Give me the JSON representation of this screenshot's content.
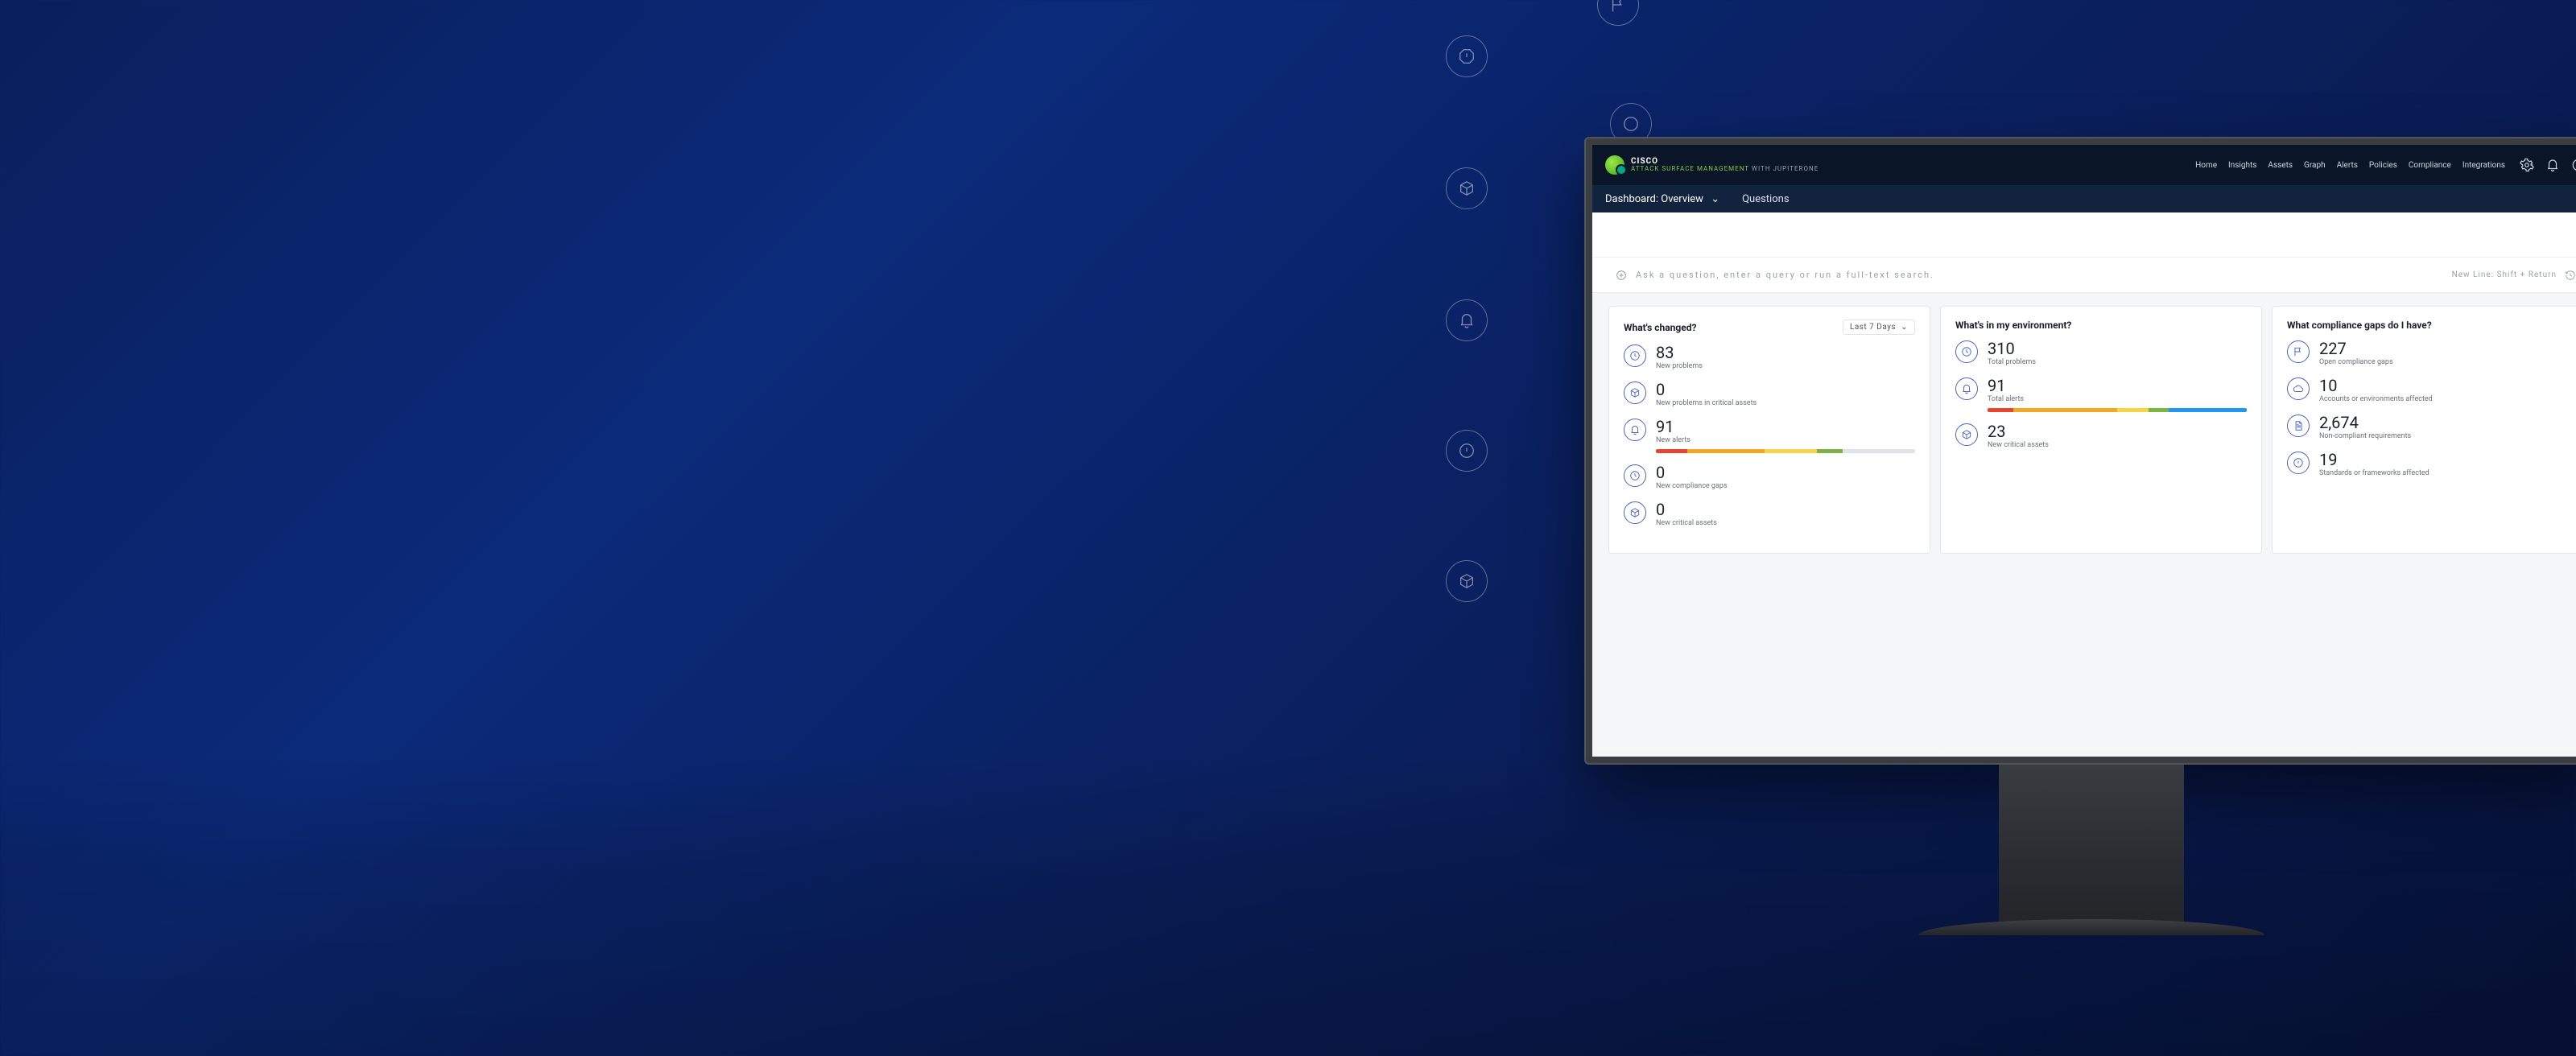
{
  "brand": {
    "top": "CISCO",
    "green": "ATTACK SURFACE MANAGEMENT",
    "grey": "WITH JUPITERONE"
  },
  "nav": {
    "home": "Home",
    "insights": "Insights",
    "assets": "Assets",
    "graph": "Graph",
    "alerts": "Alerts",
    "policies": "Policies",
    "compliance": "Compliance",
    "integrations": "Integrations"
  },
  "subnav": {
    "dashboard": "Dashboard: Overview",
    "questions": "Questions"
  },
  "search": {
    "placeholder": "Ask a question, enter a query or run a full-text search.",
    "hint": "New Line:  Shift + Return"
  },
  "cards": {
    "changed": {
      "title": "What's changed?",
      "range": "Last 7 Days",
      "m1": {
        "num": "83",
        "lab": "New problems"
      },
      "m2": {
        "num": "0",
        "lab": "New problems in critical assets"
      },
      "m3": {
        "num": "91",
        "lab": "New alerts"
      },
      "m4": {
        "num": "0",
        "lab": "New compliance gaps"
      },
      "m5": {
        "num": "0",
        "lab": "New critical assets"
      }
    },
    "env": {
      "title": "What's in my environment?",
      "m1": {
        "num": "310",
        "lab": "Total problems"
      },
      "m2": {
        "num": "91",
        "lab": "Total alerts"
      },
      "m3": {
        "num": "23",
        "lab": "New critical assets"
      }
    },
    "gaps": {
      "title": "What compliance gaps do I have?",
      "m1": {
        "num": "227",
        "lab": "Open compliance gaps"
      },
      "m2": {
        "num": "10",
        "lab": "Accounts or environments affected"
      },
      "m3": {
        "num": "2,674",
        "lab": "Non-compliant requirements"
      },
      "m4": {
        "num": "19",
        "lab": "Standards or frameworks affected"
      }
    }
  }
}
